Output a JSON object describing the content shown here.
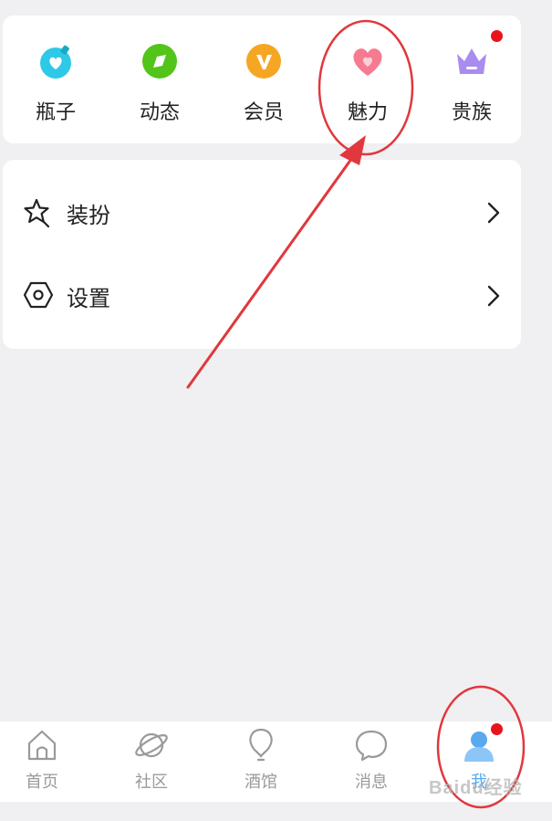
{
  "quick_access": [
    {
      "label": "瓶子",
      "icon": "bottle-heart-icon",
      "color": "#2ec9e6",
      "badge": false
    },
    {
      "label": "动态",
      "icon": "compass-leaf-icon",
      "color": "#52c41a",
      "badge": false
    },
    {
      "label": "会员",
      "icon": "vip-v-icon",
      "color": "#f5a623",
      "badge": false
    },
    {
      "label": "魅力",
      "icon": "heart-icon",
      "color": "#f77b90",
      "badge": false
    },
    {
      "label": "贵族",
      "icon": "crown-icon",
      "color": "#a98cf0",
      "badge": true
    }
  ],
  "menu": [
    {
      "label": "装扮",
      "icon": "star-outline-icon"
    },
    {
      "label": "设置",
      "icon": "hexagon-settings-icon"
    }
  ],
  "tabs": [
    {
      "label": "首页",
      "icon": "home-icon",
      "active": false
    },
    {
      "label": "社区",
      "icon": "planet-icon",
      "active": false
    },
    {
      "label": "酒馆",
      "icon": "balloon-icon",
      "active": false
    },
    {
      "label": "消息",
      "icon": "chat-bubble-icon",
      "active": false
    },
    {
      "label": "我",
      "icon": "user-avatar-icon",
      "active": true,
      "badge": true
    }
  ],
  "colors": {
    "background": "#f0f0f2",
    "card": "#ffffff",
    "text": "#222222",
    "tab_inactive": "#9a9a9a",
    "tab_active": "#5aa8f0",
    "badge": "#e8141c",
    "annotation": "#e0383e"
  },
  "watermark": "Baidu经验"
}
